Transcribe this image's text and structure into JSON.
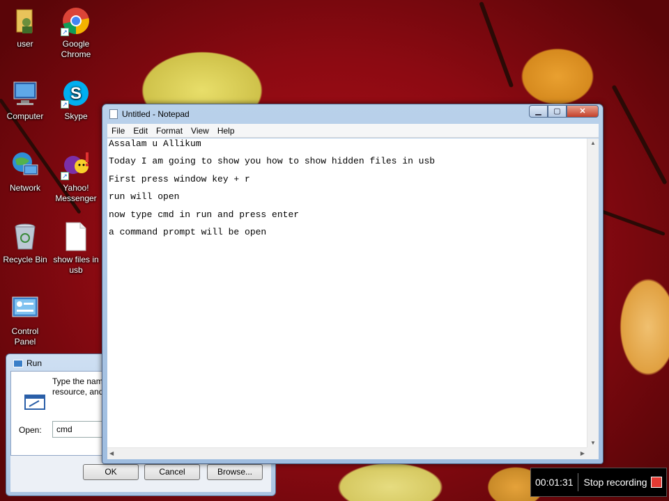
{
  "desktop_icons": [
    {
      "label": "user",
      "icon": "user-folder-icon"
    },
    {
      "label": "Google Chrome",
      "icon": "chrome-icon"
    },
    {
      "label": "Computer",
      "icon": "computer-icon"
    },
    {
      "label": "Skype",
      "icon": "skype-icon"
    },
    {
      "label": "Network",
      "icon": "network-icon"
    },
    {
      "label": "Yahoo! Messenger",
      "icon": "yahoo-messenger-icon"
    },
    {
      "label": "Recycle Bin",
      "icon": "recycle-bin-icon"
    },
    {
      "label": "show files in usb",
      "icon": "text-file-icon"
    },
    {
      "label": "Control Panel",
      "icon": "control-panel-icon"
    }
  ],
  "run_dialog": {
    "title": "Run",
    "description": "Type the nam\nresource, and",
    "open_label": "Open:",
    "open_value": "cmd",
    "ok_label": "OK",
    "cancel_label": "Cancel",
    "browse_label": "Browse..."
  },
  "notepad": {
    "title": "Untitled - Notepad",
    "menu": [
      "File",
      "Edit",
      "Format",
      "View",
      "Help"
    ],
    "lines": [
      "Assalam u Allikum",
      "Today I am going to show you how to show hidden files in usb",
      "First press window key + r",
      "run will open",
      "now type cmd in run and press enter",
      "a command prompt will be open"
    ]
  },
  "recorder": {
    "time": "00:01:31",
    "stop_label": "Stop recording"
  },
  "colors": {
    "titlebar": "#b9d1ea",
    "close_button": "#c4402a",
    "stop_square": "#e23a33"
  }
}
